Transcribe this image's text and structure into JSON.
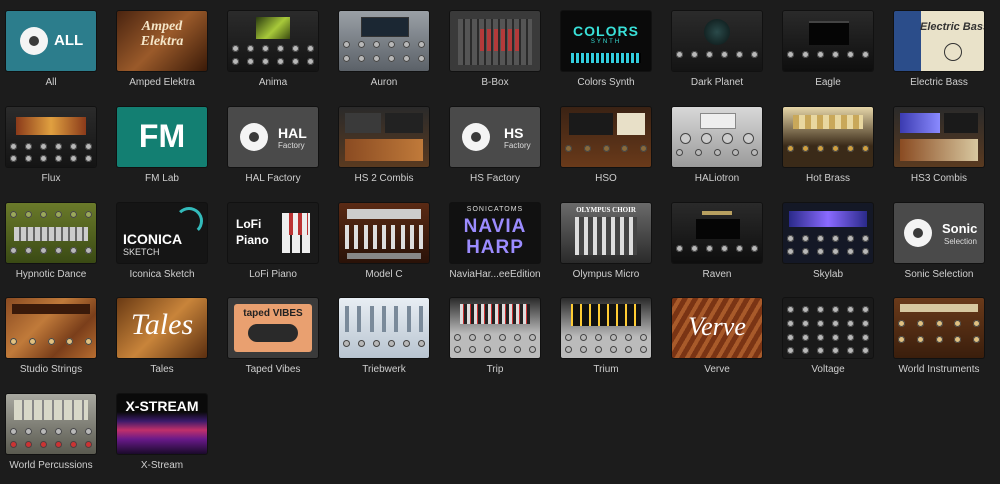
{
  "library": {
    "items": [
      {
        "label": "All",
        "thumb_text": "ALL"
      },
      {
        "label": "Amped Elektra",
        "thumb_text": "Amped Elektra"
      },
      {
        "label": "Anima",
        "thumb_text": ""
      },
      {
        "label": "Auron",
        "thumb_text": ""
      },
      {
        "label": "B-Box",
        "thumb_text": ""
      },
      {
        "label": "Colors Synth",
        "thumb_text": "COLORS",
        "thumb_sub": "SYNTH"
      },
      {
        "label": "Dark Planet",
        "thumb_text": ""
      },
      {
        "label": "Eagle",
        "thumb_text": ""
      },
      {
        "label": "Electric Bass",
        "thumb_text": "Electric Bass"
      },
      {
        "label": "Flux",
        "thumb_text": ""
      },
      {
        "label": "FM Lab",
        "thumb_text": "FM"
      },
      {
        "label": "HAL Factory",
        "thumb_text": "HAL",
        "thumb_sub": "Factory"
      },
      {
        "label": "HS 2 Combis",
        "thumb_text": ""
      },
      {
        "label": "HS Factory",
        "thumb_text": "HS",
        "thumb_sub": "Factory"
      },
      {
        "label": "HSO",
        "thumb_text": ""
      },
      {
        "label": "HALiotron",
        "thumb_text": ""
      },
      {
        "label": "Hot Brass",
        "thumb_text": ""
      },
      {
        "label": "HS3 Combis",
        "thumb_text": ""
      },
      {
        "label": "Hypnotic Dance",
        "thumb_text": ""
      },
      {
        "label": "Iconica Sketch",
        "thumb_text": "ICONICA",
        "thumb_sub": "SKETCH"
      },
      {
        "label": "LoFi Piano",
        "thumb_text": "LoFi",
        "thumb_sub": "Piano"
      },
      {
        "label": "Model C",
        "thumb_text": ""
      },
      {
        "label": "NaviaHar...eeEdition",
        "thumb_text": "NAVIA",
        "thumb_sub": "HARP",
        "thumb_top": "SONICATOMS"
      },
      {
        "label": "Olympus Micro",
        "thumb_text": "OLYMPUS CHOIR"
      },
      {
        "label": "Raven",
        "thumb_text": ""
      },
      {
        "label": "Skylab",
        "thumb_text": ""
      },
      {
        "label": "Sonic Selection",
        "thumb_text": "Sonic",
        "thumb_sub": "Selection"
      },
      {
        "label": "Studio Strings",
        "thumb_text": ""
      },
      {
        "label": "Tales",
        "thumb_text": "Tales"
      },
      {
        "label": "Taped Vibes",
        "thumb_text": "taped VIBES"
      },
      {
        "label": "Triebwerk",
        "thumb_text": ""
      },
      {
        "label": "Trip",
        "thumb_text": ""
      },
      {
        "label": "Trium",
        "thumb_text": ""
      },
      {
        "label": "Verve",
        "thumb_text": "Verve"
      },
      {
        "label": "Voltage",
        "thumb_text": ""
      },
      {
        "label": "World Instruments",
        "thumb_text": ""
      },
      {
        "label": "World Percussions",
        "thumb_text": ""
      },
      {
        "label": "X-Stream",
        "thumb_text": "X-STREAM"
      }
    ]
  },
  "colors": {
    "background": "#1c1c1c",
    "label_text": "#cfcfcf",
    "teal": "#2a7c7a",
    "gray_tile": "#4a4a4a"
  }
}
